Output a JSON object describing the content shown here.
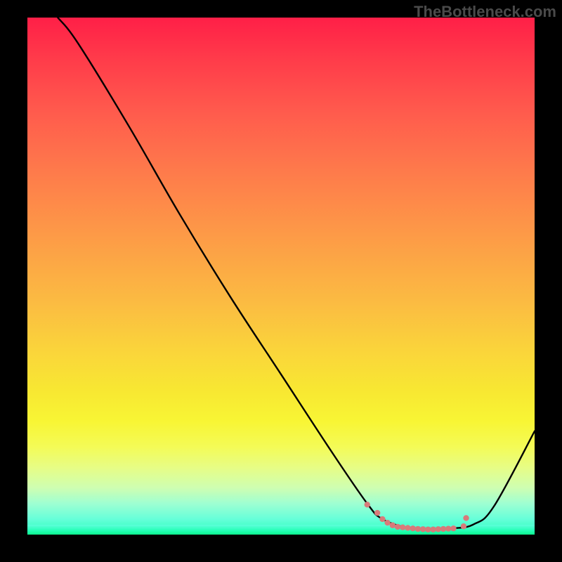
{
  "watermark": "TheBottleneck.com",
  "chart_data": {
    "type": "line",
    "title": "",
    "xlabel": "",
    "ylabel": "",
    "xlim": [
      0,
      100
    ],
    "ylim": [
      0,
      100
    ],
    "grid": false,
    "series": [
      {
        "name": "main-curve",
        "color": "#000000",
        "x": [
          6,
          10,
          20,
          30,
          40,
          50,
          60,
          67,
          70,
          75,
          80,
          84,
          88,
          92,
          100
        ],
        "values": [
          100,
          95,
          79,
          62,
          46,
          31,
          16,
          6,
          3,
          1.3,
          1,
          1.2,
          2,
          5.5,
          20
        ]
      },
      {
        "name": "valley-markers",
        "type": "scatter",
        "color": "#d87a7a",
        "x": [
          67,
          69,
          70,
          71,
          72,
          73,
          74,
          75,
          76,
          77,
          78,
          79,
          80,
          81,
          82,
          83,
          84,
          86,
          86.5
        ],
        "values": [
          5.8,
          4.2,
          3.0,
          2.3,
          1.8,
          1.5,
          1.4,
          1.3,
          1.2,
          1.1,
          1.05,
          1.0,
          1.0,
          1.05,
          1.1,
          1.15,
          1.2,
          1.6,
          3.2
        ]
      }
    ],
    "background_gradient": {
      "from": "#ff1f47",
      "to": "#0cf58e",
      "stops": [
        "red",
        "orange",
        "yellow",
        "green"
      ]
    }
  }
}
